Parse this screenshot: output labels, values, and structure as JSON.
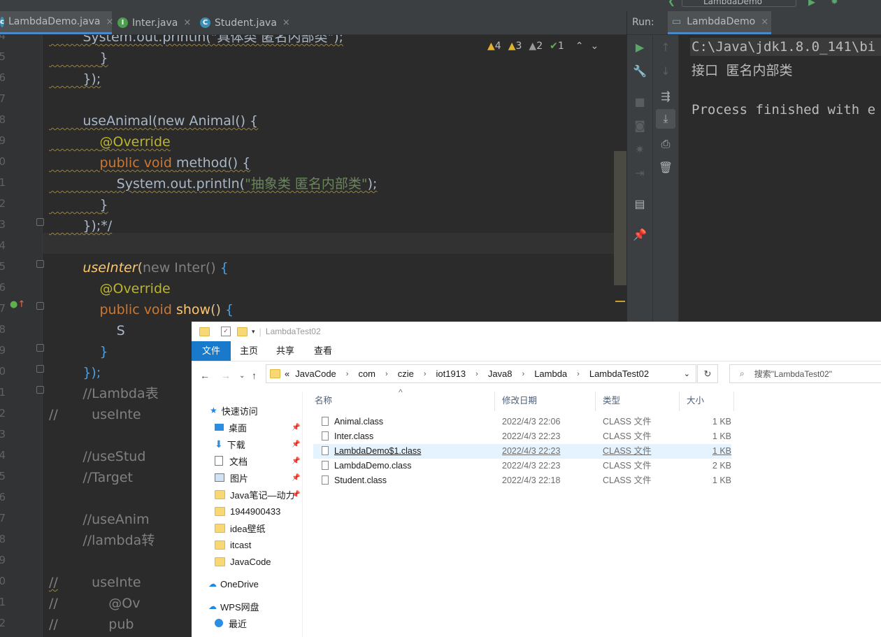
{
  "ide": {
    "tabs": [
      {
        "label": "LambdaDemo.java",
        "icon": "java-file-icon",
        "active": true
      },
      {
        "label": "Inter.java",
        "icon": "interface-icon"
      },
      {
        "label": "Student.java",
        "icon": "class-icon"
      }
    ],
    "close_glyph": "×",
    "inspections": {
      "warn1": "4",
      "warn2": "3",
      "warn3": "2",
      "ok": "1"
    },
    "line_numbers": [
      "4",
      "5",
      "6",
      "7",
      "8",
      "9",
      "0",
      "1",
      "2",
      "3",
      "4",
      "5",
      "6",
      "7",
      "8",
      "9",
      "0",
      "1",
      "2",
      "3",
      "4",
      "5",
      "6",
      "7",
      "8",
      "9",
      "0",
      "1",
      "2",
      "3"
    ],
    "code": {
      "l0": "System.out.println(\"具体类 匿名内部类\");",
      "l1": "}",
      "l2": "});",
      "l4_call": "useAnimal",
      "l4_rest": "(new Animal() {",
      "l5": "@Override",
      "l6_kw": "public void ",
      "l6_fn": "method",
      "l6_rest": "() {",
      "l7_pre": "System.out.println(",
      "l7_str": "\"抽象类 匿名内部类\"",
      "l7_post": ");",
      "l8": "}",
      "l9": "});*/",
      "l11_call": "useInter",
      "l11_p": "(",
      "l11_new": "new Inter() ",
      "l11_b": "{",
      "l12": "@Override",
      "l13_kw": "public void ",
      "l13_fn": "show",
      "l13_p": "() ",
      "l13_b": "{",
      "l14": "S",
      "l15": "}",
      "l16": "});",
      "l17": "//Lambda表",
      "l18_c": "//",
      "l18_r": "useInte",
      "l20": "//useStud",
      "l21": "//Target ",
      "l23": "//useAnim",
      "l24": "//lambda转",
      "l26_c": "//",
      "l26_r": "useInte",
      "l27_c": "//",
      "l27_r": "@Ov",
      "l28_c": "//",
      "l28_r": "pub"
    }
  },
  "run": {
    "label": "Run:",
    "config": "LambdaDemo",
    "config_top": "LambdaDemo",
    "console": [
      "C:\\Java\\jdk1.8.0_141\\bi",
      "接口 匿名内部类",
      "",
      "Process finished with e"
    ]
  },
  "explorer": {
    "title": "LambdaTest02",
    "ribbon": [
      "文件",
      "主页",
      "共享",
      "查看"
    ],
    "breadcrumb_prefix": "«",
    "breadcrumb": [
      "JavaCode",
      "com",
      "czie",
      "iot1913",
      "Java8",
      "Lambda",
      "LambdaTest02"
    ],
    "search_placeholder": "搜索\"LambdaTest02\"",
    "nav": [
      {
        "label": "快速访问",
        "icon": "star-icon"
      },
      {
        "label": "桌面",
        "icon": "desktop-icon",
        "pinned": true
      },
      {
        "label": "下载",
        "icon": "download-icon",
        "pinned": true
      },
      {
        "label": "文档",
        "icon": "document-icon",
        "pinned": true
      },
      {
        "label": "图片",
        "icon": "picture-icon",
        "pinned": true
      },
      {
        "label": "Java笔记—动力",
        "icon": "folder-icon",
        "pinned": true
      },
      {
        "label": "1944900433",
        "icon": "folder-icon"
      },
      {
        "label": "idea壁纸",
        "icon": "folder-icon"
      },
      {
        "label": "itcast",
        "icon": "folder-icon"
      },
      {
        "label": "JavaCode",
        "icon": "folder-icon"
      },
      {
        "label": "OneDrive",
        "icon": "cloud-icon"
      },
      {
        "label": "WPS网盘",
        "icon": "cloud-icon"
      },
      {
        "label": "最近",
        "icon": "clock-icon"
      }
    ],
    "columns": [
      "名称",
      "修改日期",
      "类型",
      "大小"
    ],
    "files": [
      {
        "name": "Animal.class",
        "date": "2022/4/3 22:06",
        "type": "CLASS 文件",
        "size": "1 KB"
      },
      {
        "name": "Inter.class",
        "date": "2022/4/3 22:23",
        "type": "CLASS 文件",
        "size": "1 KB"
      },
      {
        "name": "LambdaDemo$1.class",
        "date": "2022/4/3 22:23",
        "type": "CLASS 文件",
        "size": "1 KB",
        "selected": true
      },
      {
        "name": "LambdaDemo.class",
        "date": "2022/4/3 22:23",
        "type": "CLASS 文件",
        "size": "2 KB"
      },
      {
        "name": "Student.class",
        "date": "2022/4/3 22:18",
        "type": "CLASS 文件",
        "size": "1 KB"
      }
    ]
  }
}
